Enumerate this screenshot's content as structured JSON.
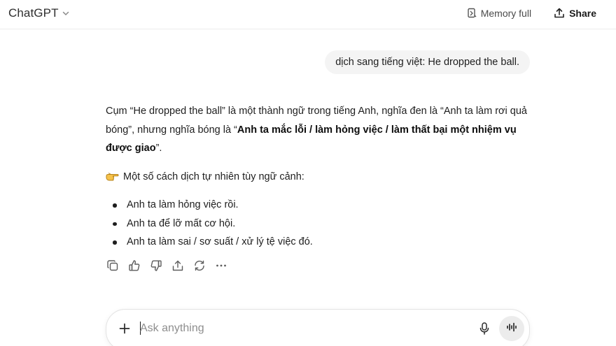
{
  "header": {
    "model_name": "ChatGPT",
    "model_chevron_icon": "chevron-down-icon",
    "memory_label": "Memory full",
    "memory_icon": "memory-icon",
    "share_label": "Share",
    "share_icon": "share-upload-icon"
  },
  "user_message": {
    "text": "dịch sang tiếng việt: He dropped the ball."
  },
  "assistant_message": {
    "para1_part1": "Cụm “He dropped the ball” là một thành ngữ trong tiếng Anh, nghĩa đen là “Anh ta làm rơi quả bóng”, nhưng nghĩa bóng là “",
    "para1_bold": "Anh ta mắc lỗi / làm hỏng việc / làm thất bại một nhiệm vụ được giao",
    "para1_part2": "”.",
    "para2_icon": "pointing-hand-emoji",
    "para2": "Một số cách dịch tự nhiên tùy ngữ cảnh:",
    "bullets": [
      "Anh ta làm hỏng việc rồi.",
      "Anh ta để lỡ mất cơ hội.",
      "Anh ta làm sai / sơ suất / xử lý tệ việc đó."
    ]
  },
  "message_actions": [
    "copy-icon",
    "thumbs-up-icon",
    "thumbs-down-icon",
    "share-icon",
    "regenerate-icon",
    "more-icon"
  ],
  "composer": {
    "placeholder": "Ask anything",
    "value": "",
    "plus_icon": "plus-icon",
    "mic_icon": "microphone-icon",
    "voice_icon": "voice-mode-icon"
  }
}
